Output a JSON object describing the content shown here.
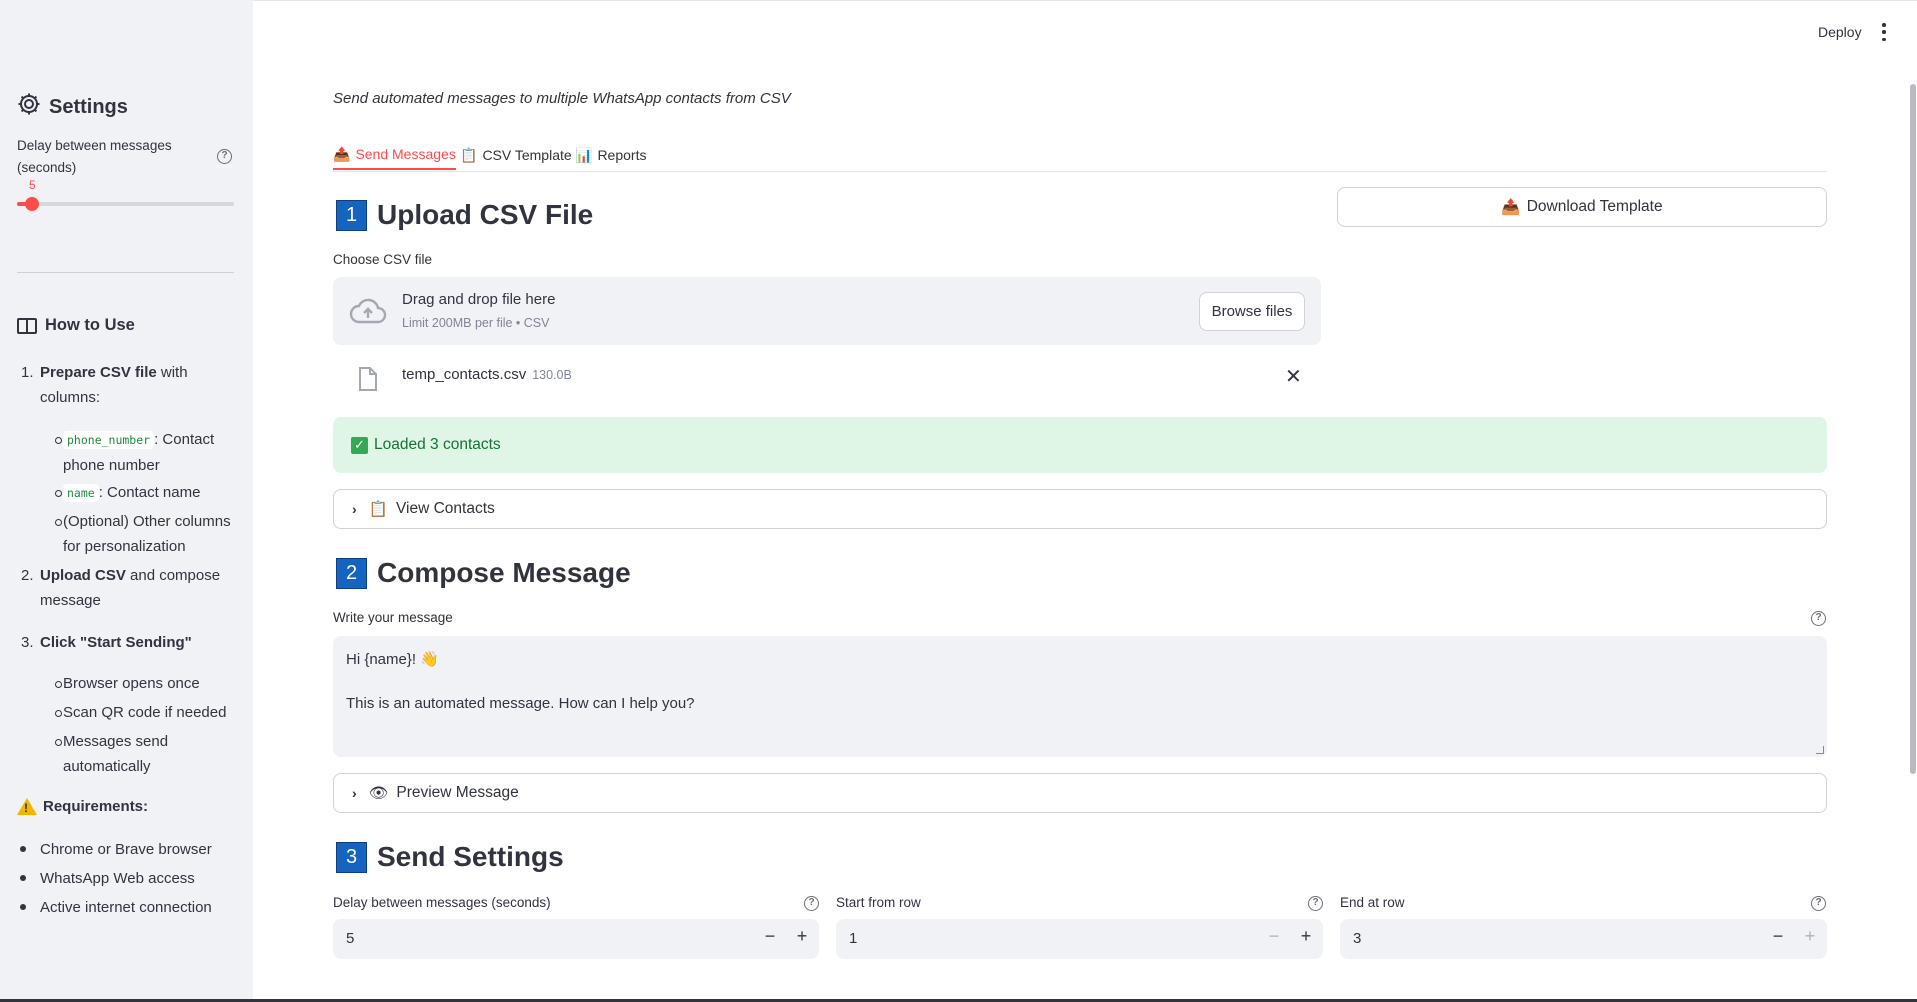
{
  "sidebar": {
    "title": "Settings",
    "delay_label": "Delay between messages (seconds)",
    "delay_value": "5",
    "delay_fraction": 0.07,
    "howto_title": "How to Use",
    "steps": [
      {
        "num": "1.",
        "bold": "Prepare CSV file",
        "rest": " with columns:"
      },
      {
        "num": "2.",
        "bold": "Upload CSV",
        "rest": " and compose message"
      },
      {
        "num": "3.",
        "bold": "Click \"Start Sending\"",
        "rest": ""
      }
    ],
    "step1_bullets": [
      {
        "code": "phone_number",
        "text": ": Contact phone number"
      },
      {
        "code": "name",
        "text": ": Contact name"
      },
      {
        "code": "",
        "text": "(Optional) Other columns for personalization"
      }
    ],
    "step3_bullets": [
      "Browser opens once",
      "Scan QR code if needed",
      "Messages send automatically"
    ],
    "requirements_title": "Requirements:",
    "requirements": [
      "Chrome or Brave browser",
      "WhatsApp Web access",
      "Active internet connection"
    ]
  },
  "header": {
    "deploy_label": "Deploy"
  },
  "main": {
    "subtitle": "Send automated messages to multiple WhatsApp contacts from CSV",
    "tabs": [
      {
        "icon": "📤",
        "label": "Send Messages"
      },
      {
        "icon": "📋",
        "label": "CSV Template"
      },
      {
        "icon": "📊",
        "label": "Reports"
      }
    ],
    "download_button": "Download Template",
    "section1": {
      "num": "1",
      "title": "Upload CSV File"
    },
    "choose_label": "Choose CSV file",
    "uploader_main": "Drag and drop file here",
    "uploader_sub": "Limit 200MB per file • CSV",
    "browse_label": "Browse files",
    "file_name": "temp_contacts.csv",
    "file_size": "130.0B",
    "success_text": "Loaded 3 contacts",
    "view_contacts": "View Contacts",
    "section2": {
      "num": "2",
      "title": "Compose Message"
    },
    "message_label": "Write your message",
    "message_line1": "Hi {name}! 👋",
    "message_line2": "",
    "message_line3": "This is an automated message. How can I help you?",
    "preview_label": "Preview Message",
    "section3": {
      "num": "3",
      "title": "Send Settings"
    },
    "inputs": [
      {
        "label": "Delay between messages (seconds)",
        "value": "5"
      },
      {
        "label": "Start from row",
        "value": "1"
      },
      {
        "label": "End at row",
        "value": "3"
      }
    ]
  },
  "colors": {
    "accent": "#ff4b4b",
    "number_box": "#1565c0",
    "success_bg": "#dff6e6"
  }
}
